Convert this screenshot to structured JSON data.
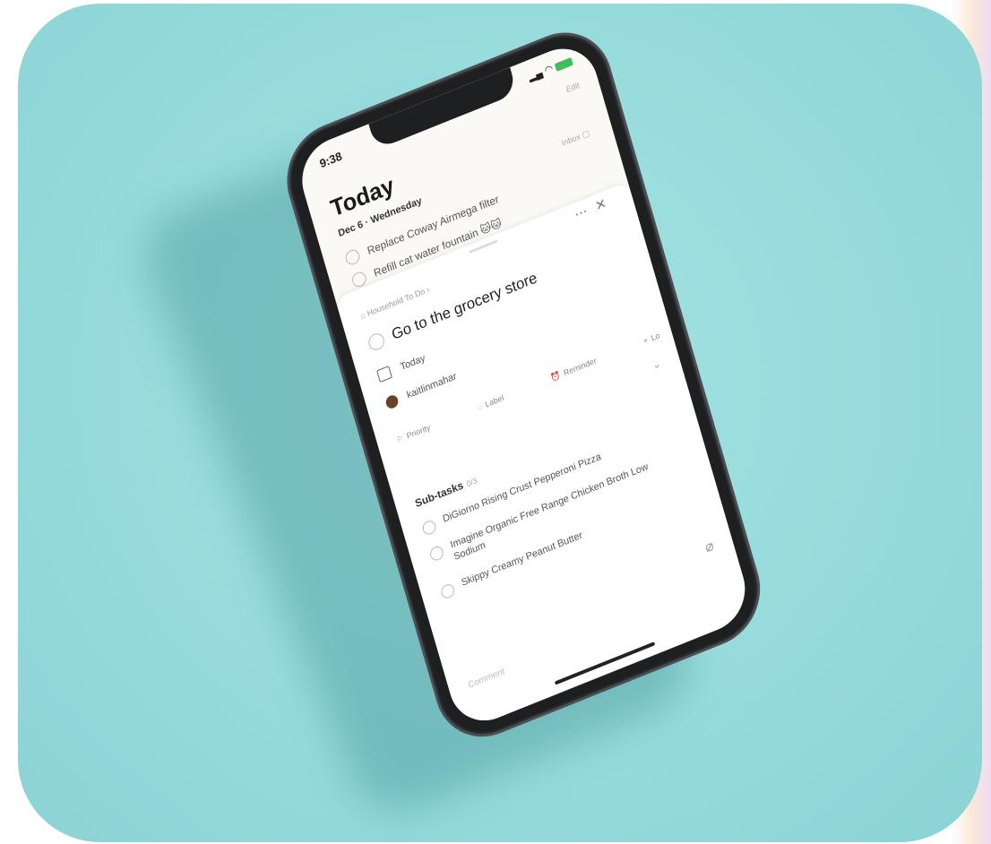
{
  "status": {
    "time": "9:38",
    "edit": "Edit"
  },
  "header": {
    "title": "Today",
    "date": "Dec 6 · Wednesday",
    "inbox": "Inbox"
  },
  "tasks": [
    {
      "label": "Replace Coway Airmega filter"
    },
    {
      "label": "Refill cat water fountain 🐱🐱"
    }
  ],
  "detail": {
    "project": "Household To Do",
    "title": "Go to the grocery store",
    "due": "Today",
    "assignee": "kaitlinmahar",
    "chips": {
      "priority": "Priority",
      "label": "Label",
      "reminder": "Reminder",
      "location": "Lo"
    },
    "subtasks_label": "Sub-tasks",
    "subtasks_count": "0/3",
    "subtasks": [
      {
        "label": "DiGiorno Rising Crust Pepperoni Pizza"
      },
      {
        "label": "Imagine Organic Free Range Chicken Broth Low Sodium"
      },
      {
        "label": "Skippy Creamy Peanut Butter"
      }
    ],
    "comment_placeholder": "Comment"
  },
  "colors": {
    "background": "#97dbdc",
    "screen": "#faf9f6",
    "phone_frame": "#1e1f21",
    "battery": "#3fbf5c"
  }
}
